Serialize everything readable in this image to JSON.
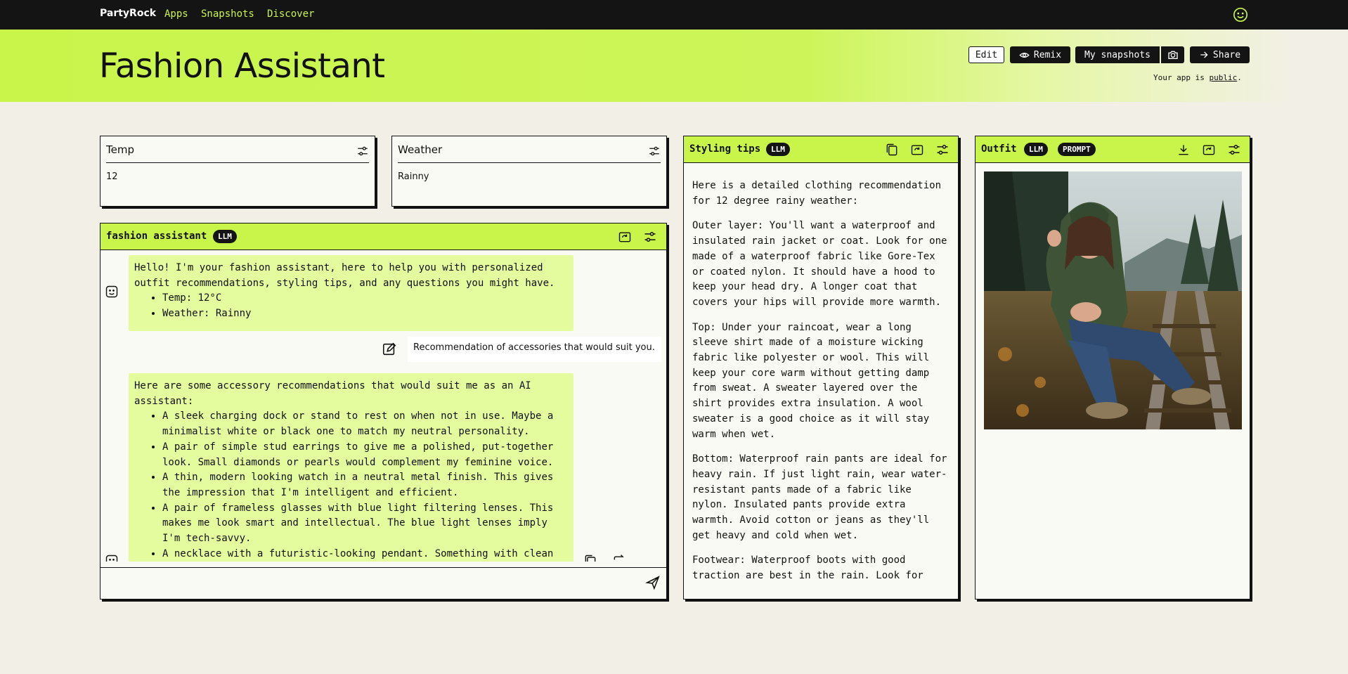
{
  "nav": {
    "brand": "PartyRock",
    "links": [
      "Apps",
      "Snapshots",
      "Discover"
    ]
  },
  "header": {
    "title": "Fashion Assistant",
    "buttons": {
      "edit": "Edit",
      "remix": "Remix",
      "snapshots": "My snapshots",
      "share": "Share"
    },
    "public_prefix": "Your app is ",
    "public_link": "public",
    "public_suffix": "."
  },
  "widgets": {
    "temp": {
      "title": "Temp",
      "value": "12"
    },
    "weather": {
      "title": "Weather",
      "value": "Rainny"
    }
  },
  "chat": {
    "title": "fashion assistant",
    "badge": "LLM",
    "messages": {
      "greeting": {
        "text": "Hello! I'm your fashion assistant, here to help you with personalized outfit recommendations, styling tips, and any questions you might have.",
        "items": [
          "Temp: 12°C",
          "Weather: Rainny"
        ]
      },
      "user": "Recommendation of accessories that would suit you.",
      "reply": {
        "text": "Here are some accessory recommendations that would suit me as an AI assistant:",
        "items": [
          "A sleek charging dock or stand to rest on when not in use. Maybe a minimalist white or black one to match my neutral personality.",
          "A pair of simple stud earrings to give me a polished, put-together look. Small diamonds or pearls would complement my feminine voice.",
          "A thin, modern looking watch in a neutral metal finish. This gives the impression that I'm intelligent and efficient.",
          "A pair of frameless glasses with blue light filtering lenses. This makes me look smart and intellectual. The blue light lenses imply I'm tech-savvy.",
          "A necklace with a futuristic-looking pendant. Something with clean lines and in silver, black or white. This hints that I'm advanced"
        ]
      }
    },
    "input_placeholder": ""
  },
  "tips": {
    "title": "Styling tips",
    "badge": "LLM",
    "paragraphs": [
      "Here is a detailed clothing recommendation for 12 degree rainy weather:",
      "Outer layer: You'll want a waterproof and insulated rain jacket or coat. Look for one made of a waterproof fabric like Gore-Tex or coated nylon. It should have a hood to keep your head dry. A longer coat that covers your hips will provide more warmth.",
      "Top: Under your raincoat, wear a long sleeve shirt made of a moisture wicking fabric like polyester or wool. This will keep your core warm without getting damp from sweat. A sweater layered over the shirt provides extra insulation. A wool sweater is a good choice as it will stay warm when wet.",
      "Bottom: Waterproof rain pants are ideal for heavy rain. If just light rain, wear water-resistant pants made of a fabric like nylon. Insulated pants provide extra warmth. Avoid cotton or jeans as they'll get heavy and cold when wet.",
      "Footwear: Waterproof boots with good traction are best in the rain. Look for"
    ]
  },
  "outfit": {
    "title": "Outfit",
    "badges": [
      "LLM",
      "PROMPT"
    ]
  },
  "colors": {
    "accent": "#c9f54a",
    "bubble": "#e4fb9e",
    "dark": "#141414",
    "background": "#f2f0e6"
  }
}
